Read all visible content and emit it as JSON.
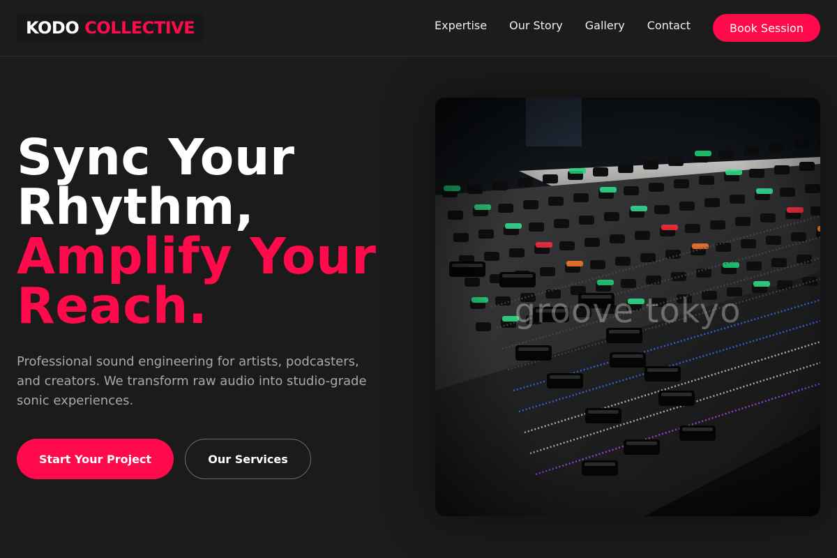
{
  "brand": {
    "word1": "KODO",
    "word2": "COLLECTIVE",
    "accent": "#ff0a4a"
  },
  "nav": {
    "links": [
      "Expertise",
      "Our Story",
      "Gallery",
      "Contact"
    ],
    "cta": "Book Session"
  },
  "hero": {
    "title_line1": "Sync Your",
    "title_line2": "Rhythm,",
    "title_line3": "Amplify Your",
    "title_line4": "Reach.",
    "description": "Professional sound engineering for artists, podcasters, and creators. We transform raw audio into studio-grade sonic experiences.",
    "primary_button": "Start Your Project",
    "secondary_button": "Our Services"
  },
  "image": {
    "subject": "audio mixing console with faders",
    "watermark": "groove tokyo"
  }
}
